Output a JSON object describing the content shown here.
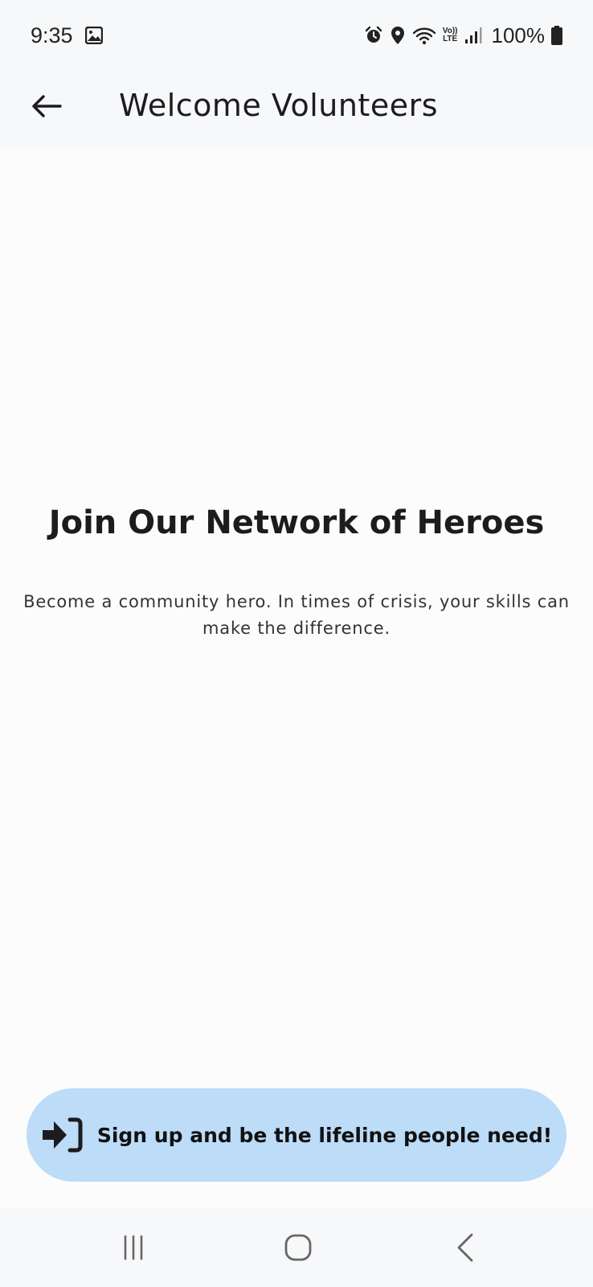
{
  "status_bar": {
    "time": "9:35",
    "battery": "100%",
    "network": {
      "top": "Vo))",
      "bottom": "LTE"
    },
    "icons": [
      "gallery-icon",
      "alarm-icon",
      "location-icon",
      "wifi-icon",
      "signal-icon",
      "battery-icon"
    ]
  },
  "app_bar": {
    "title": "Welcome Volunteers",
    "back_icon": "arrow-back-icon"
  },
  "hero": {
    "title": "Join Our Network of Heroes",
    "subtitle": "Become a community hero. In times of crisis, your skills can make the difference."
  },
  "cta": {
    "label": "Sign up and be the lifeline people need!",
    "icon": "login-icon"
  },
  "nav_bar": {
    "icons": [
      "recent-apps-icon",
      "home-icon",
      "back-icon"
    ]
  },
  "colors": {
    "background": "#fcfcfd",
    "bar_background": "#f7f8fa",
    "cta_background": "#bcdcf7",
    "text": "#1c1c1e"
  }
}
